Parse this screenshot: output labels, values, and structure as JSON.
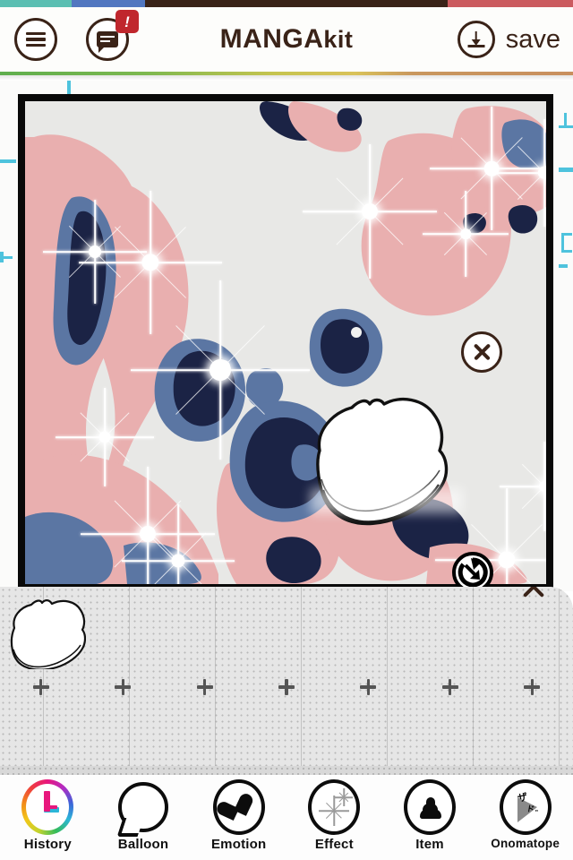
{
  "top_strip_colors": [
    "#5bbfb2",
    "#5277c0",
    "#3a2318",
    "#cb5b5f"
  ],
  "header": {
    "title_main": "MANGA",
    "title_sub": "kit",
    "menu_icon": "hamburger-menu-icon",
    "chat_icon": "chat-bubble-icon",
    "chat_badge": "!",
    "chat_badge_color": "#c0272d",
    "save_label": "save",
    "save_icon": "download-icon",
    "ink_color": "#3a2318"
  },
  "canvas": {
    "frame_border_color": "#090909",
    "photo_background": "#e8e8e6",
    "photo_tone_pink": "#e9afaf",
    "photo_tone_slate": "#5b76a3",
    "photo_tone_navy": "#1b2345",
    "subject": "posterized-dog-photo",
    "effect": "sparkle-stars",
    "guide_color": "#4ec3dd"
  },
  "sticker": {
    "name": "bread-slice-sticker",
    "delete_label": "x",
    "delete_icon": "close-circle-icon",
    "rotate_icon": "rotate-resize-icon"
  },
  "drawer": {
    "close_label": "x",
    "close_icon": "close-icon",
    "background": "#e6e6e6",
    "slot_marker": "+",
    "slots": [
      "bread-slice-item",
      "",
      "",
      "",
      "",
      "",
      ""
    ],
    "selected_item": "bread-slice-item"
  },
  "bottom_nav": {
    "items": [
      {
        "label": "History",
        "icon": "history-clock-icon"
      },
      {
        "label": "Balloon",
        "icon": "speech-balloon-icon"
      },
      {
        "label": "Emotion",
        "icon": "heart-icon"
      },
      {
        "label": "Effect",
        "icon": "sparkle-icon"
      },
      {
        "label": "Item",
        "icon": "poop-item-icon"
      },
      {
        "label": "Onomatope",
        "icon": "onomatope-icon"
      }
    ],
    "active": "Item"
  }
}
